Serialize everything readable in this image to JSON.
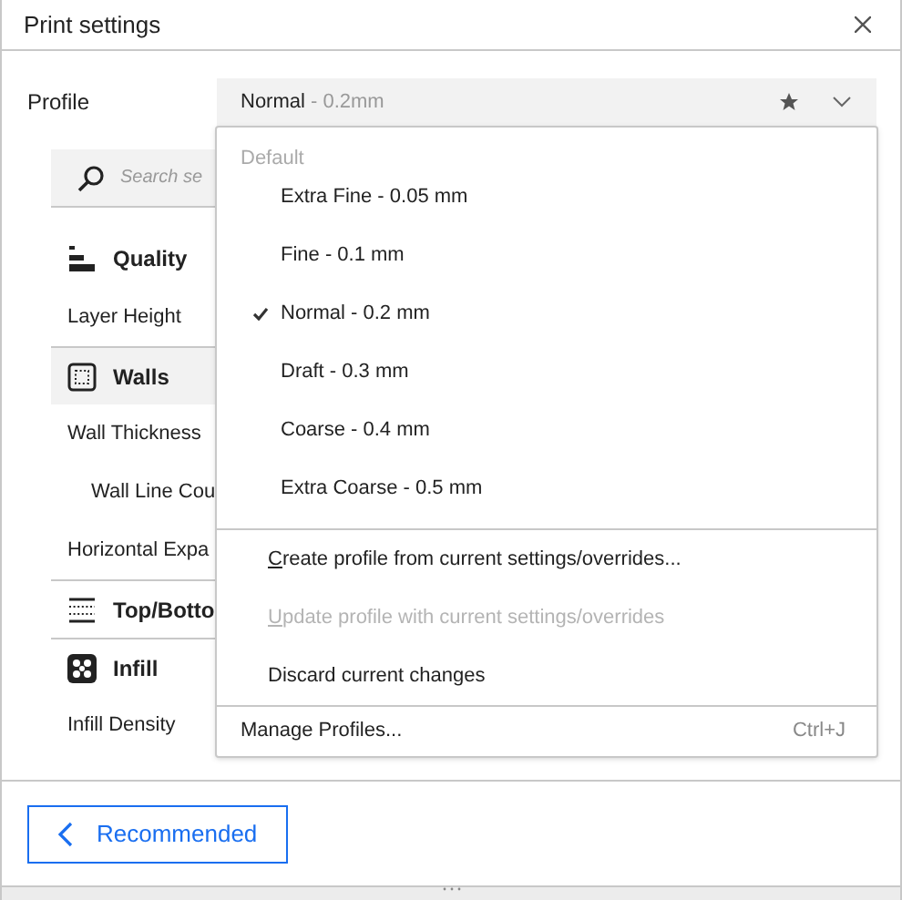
{
  "window": {
    "title": "Print settings"
  },
  "profile": {
    "label": "Profile",
    "name": "Normal",
    "detail": " - 0.2mm"
  },
  "search": {
    "placeholder": "Search se"
  },
  "categories": [
    {
      "title": "Quality",
      "highlighted": false,
      "settings": [
        {
          "label": "Layer Height"
        }
      ]
    },
    {
      "title": "Walls",
      "highlighted": true,
      "settings": [
        {
          "label": "Wall Thickness",
          "children": [
            {
              "label": "Wall Line Cou"
            }
          ]
        },
        {
          "label": "Horizontal Expa"
        }
      ]
    },
    {
      "title": "Top/Botto",
      "highlighted": false
    },
    {
      "title": "Infill",
      "highlighted": false,
      "settings": [
        {
          "label": "Infill Density"
        }
      ]
    }
  ],
  "menu": {
    "section": "Default",
    "profiles": [
      {
        "label": "Extra Fine - 0.05 mm",
        "selected": false
      },
      {
        "label": "Fine - 0.1 mm",
        "selected": false
      },
      {
        "label": "Normal - 0.2 mm",
        "selected": true
      },
      {
        "label": "Draft - 0.3 mm",
        "selected": false
      },
      {
        "label": "Coarse - 0.4 mm",
        "selected": false
      },
      {
        "label": "Extra Coarse - 0.5 mm",
        "selected": false
      }
    ],
    "actions": [
      {
        "label": "Create profile from current settings/overrides...",
        "disabled": false,
        "mnemonic": true
      },
      {
        "label": "Update profile with current settings/overrides",
        "disabled": true,
        "mnemonic": true
      },
      {
        "label": "Discard current changes",
        "disabled": false,
        "mnemonic": false
      }
    ],
    "manage": {
      "label": "Manage Profiles...",
      "shortcut": "Ctrl+J"
    }
  },
  "footer": {
    "button": "Recommended"
  }
}
